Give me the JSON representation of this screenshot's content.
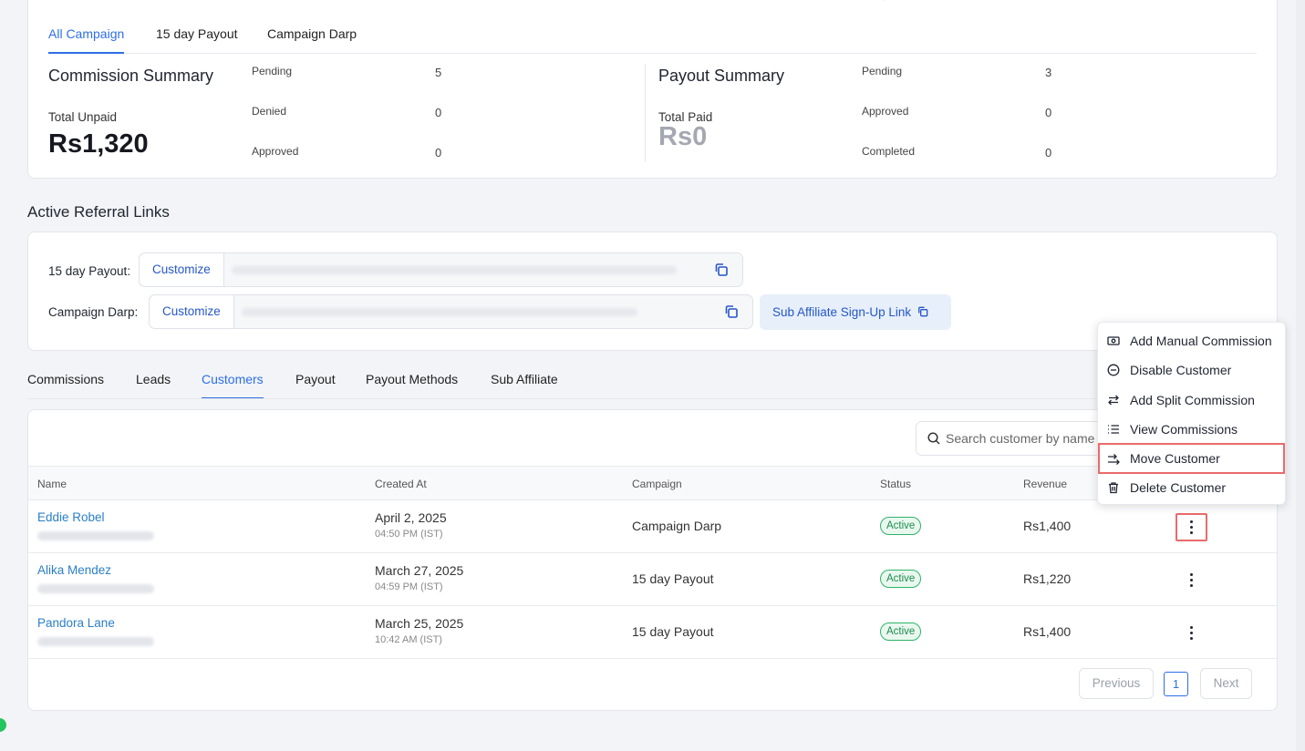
{
  "campaign_tabs": [
    "All Campaign",
    "15 day Payout",
    "Campaign Darp"
  ],
  "commission_summary": {
    "title": "Commission Summary",
    "total_label": "Total Unpaid",
    "total_value": "Rs1,320",
    "stats": [
      {
        "label": "Pending",
        "value": "5"
      },
      {
        "label": "Denied",
        "value": "0"
      },
      {
        "label": "Approved",
        "value": "0"
      }
    ]
  },
  "payout_summary": {
    "title": "Payout Summary",
    "total_label": "Total Paid",
    "total_value": "Rs0",
    "stats": [
      {
        "label": "Pending",
        "value": "3"
      },
      {
        "label": "Approved",
        "value": "0"
      },
      {
        "label": "Completed",
        "value": "0"
      }
    ]
  },
  "referral": {
    "section_title": "Active Referral Links",
    "links": [
      {
        "label": "15 day Payout:",
        "customize": "Customize"
      },
      {
        "label": "Campaign Darp:",
        "customize": "Customize"
      }
    ],
    "sub_affiliate_link": "Sub Affiliate Sign-Up Link"
  },
  "main_tabs": [
    "Commissions",
    "Leads",
    "Customers",
    "Payout",
    "Payout Methods",
    "Sub Affiliate"
  ],
  "active_main_tab": "Customers",
  "search": {
    "placeholder": "Search customer by name"
  },
  "table": {
    "columns": [
      "Name",
      "Created At",
      "Campaign",
      "Status",
      "Revenue"
    ],
    "rows": [
      {
        "name": "Eddie Robel",
        "date": "April 2, 2025",
        "time": "04:50 PM (IST)",
        "campaign": "Campaign Darp",
        "status": "Active",
        "revenue": "Rs1,400"
      },
      {
        "name": "Alika Mendez",
        "date": "March 27, 2025",
        "time": "04:59 PM (IST)",
        "campaign": "15 day Payout",
        "status": "Active",
        "revenue": "Rs1,220"
      },
      {
        "name": "Pandora Lane",
        "date": "March 25, 2025",
        "time": "10:42 AM (IST)",
        "campaign": "15 day Payout",
        "status": "Active",
        "revenue": "Rs1,400"
      }
    ]
  },
  "pagination": {
    "previous": "Previous",
    "current": "1",
    "next": "Next"
  },
  "row_menu": {
    "items": [
      {
        "label": "Add Manual Commission",
        "icon": "banknote-icon"
      },
      {
        "label": "Disable Customer",
        "icon": "minus-circle-icon"
      },
      {
        "label": "Add Split Commission",
        "icon": "arrows-swap-icon"
      },
      {
        "label": "View Commissions",
        "icon": "list-icon"
      },
      {
        "label": "Move Customer",
        "icon": "move-arrow-icon"
      },
      {
        "label": "Delete Customer",
        "icon": "trash-icon"
      }
    ]
  },
  "colors": {
    "accent": "#2d6ee6",
    "link": "#2a7fc7",
    "status_active": "#2fb36a",
    "highlight": "#e96b6b"
  }
}
